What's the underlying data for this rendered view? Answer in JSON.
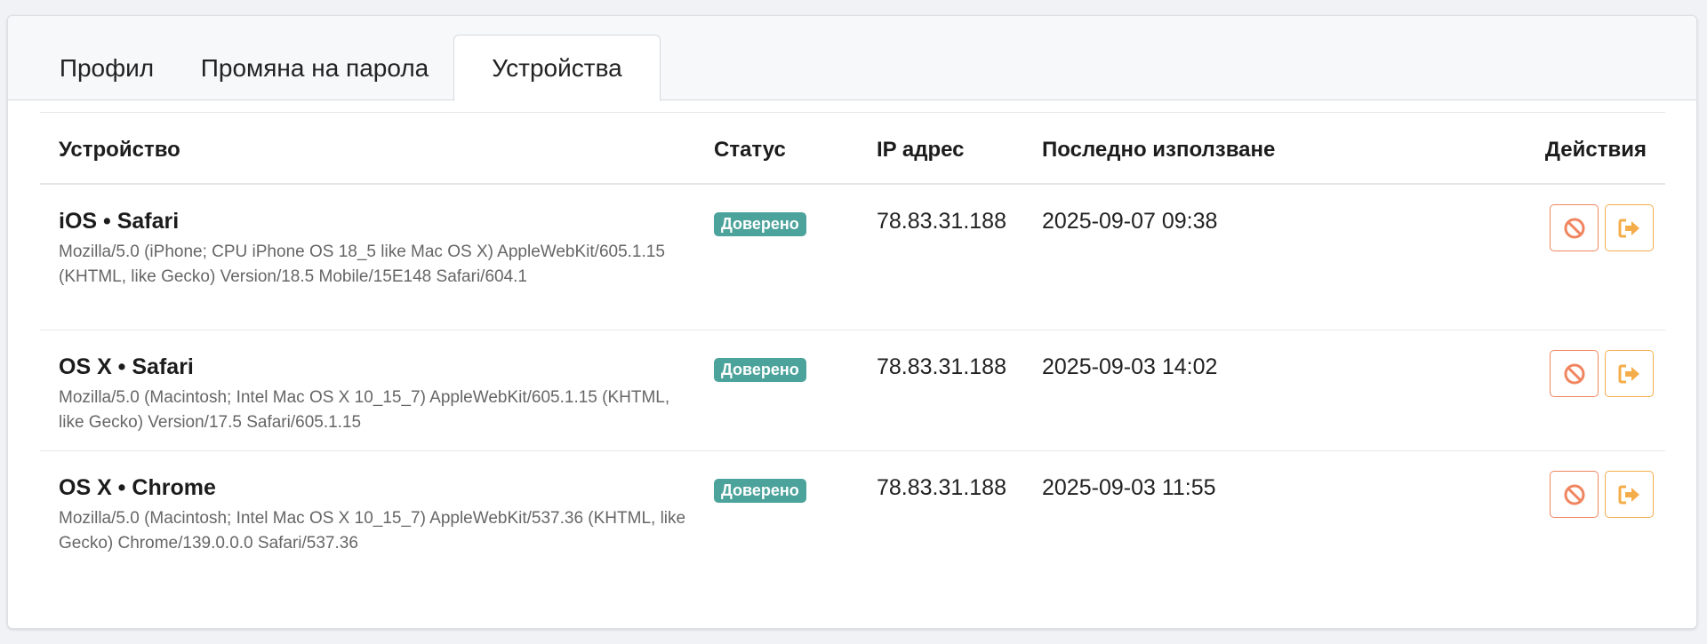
{
  "tabs": [
    {
      "label": "Профил"
    },
    {
      "label": "Промяна на парола"
    },
    {
      "label": "Устройства"
    }
  ],
  "table": {
    "headers": {
      "device": "Устройство",
      "status": "Статус",
      "ip": "IP адрес",
      "last_used": "Последно използване",
      "actions": "Действия"
    },
    "rows": [
      {
        "device": "iOS • Safari",
        "user_agent": "Mozilla/5.0 (iPhone; CPU iPhone OS 18_5 like Mac OS X) AppleWebKit/605.1.15 (KHTML, like Gecko) Version/18.5 Mobile/15E148 Safari/604.1",
        "status": "Доверено",
        "ip": "78.83.31.188",
        "last_used": "2025-09-07 09:38"
      },
      {
        "device": "OS X • Safari",
        "user_agent": "Mozilla/5.0 (Macintosh; Intel Mac OS X 10_15_7) AppleWebKit/605.1.15 (KHTML, like Gecko) Version/17.5 Safari/605.1.15",
        "status": "Доверено",
        "ip": "78.83.31.188",
        "last_used": "2025-09-03 14:02"
      },
      {
        "device": "OS X • Chrome",
        "user_agent": "Mozilla/5.0 (Macintosh; Intel Mac OS X 10_15_7) AppleWebKit/537.36 (KHTML, like Gecko) Chrome/139.0.0.0 Safari/537.36",
        "status": "Доверено",
        "ip": "78.83.31.188",
        "last_used": "2025-09-03 11:55"
      }
    ]
  },
  "icons": {
    "block": "block-icon",
    "logout": "sign-out-icon"
  },
  "colors": {
    "badge_trusted": "#4ca39b",
    "block_button": "#f08560",
    "logout_button": "#f4ad4a"
  }
}
